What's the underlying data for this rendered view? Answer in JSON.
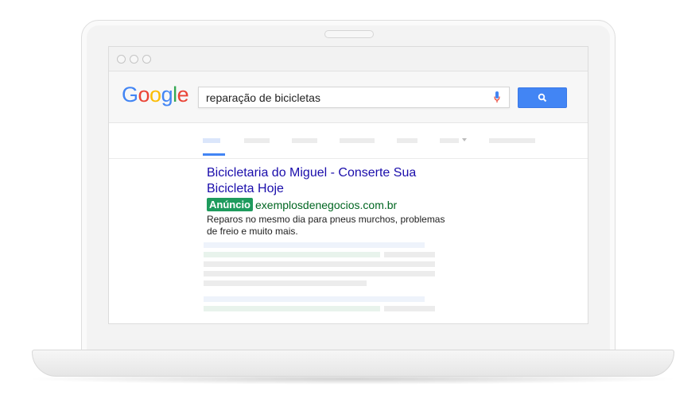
{
  "search": {
    "logo_letters": [
      {
        "char": "G",
        "color": "#4285F4"
      },
      {
        "char": "o",
        "color": "#EA4335"
      },
      {
        "char": "o",
        "color": "#FBBC05"
      },
      {
        "char": "g",
        "color": "#4285F4"
      },
      {
        "char": "l",
        "color": "#34A853"
      },
      {
        "char": "e",
        "color": "#EA4335"
      }
    ],
    "query": "reparação de bicicletas",
    "mic_icon": "microphone-icon",
    "search_icon": "magnifier-icon",
    "button_color": "#4285F4"
  },
  "ad": {
    "title_line1": "Bicicletaria do Miguel - Conserte Sua",
    "title_line2": "Bicicleta Hoje",
    "badge": "Anúncio",
    "badge_color": "#1E9B5D",
    "url": "exemplosdenegocios.com.br",
    "url_color": "#006621",
    "description_line1": "Reparos no mesmo dia para pneus murchos, problemas",
    "description_line2": "de freio e muito mais.",
    "title_color": "#1A0DAB"
  }
}
